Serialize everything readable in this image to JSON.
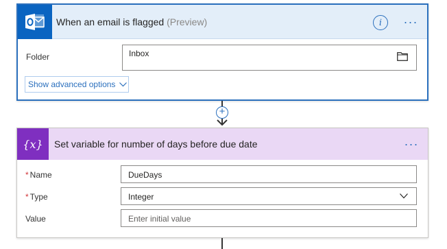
{
  "trigger": {
    "title": "When an email is flagged",
    "title_suffix": "(Preview)",
    "app_icon": "outlook-icon",
    "folder_label": "Folder",
    "folder_value": "Inbox",
    "advanced_options_label": "Show advanced options"
  },
  "variable_step": {
    "title": "Set variable for number of days before due date",
    "app_icon_text": "{x}",
    "fields": {
      "name": {
        "label": "Name",
        "required_mark": "*",
        "value": "DueDays"
      },
      "type": {
        "label": "Type",
        "required_mark": "*",
        "value": "Integer"
      },
      "value": {
        "label": "Value",
        "placeholder": "Enter initial value"
      }
    }
  },
  "colors": {
    "accent_blue": "#2a6fbd",
    "outlook_blue": "#0a64c1",
    "variable_purple": "#7f2fc0",
    "trigger_header_bg": "#e3eef9",
    "variable_header_bg": "#ead8f5",
    "required_red": "#d13438"
  }
}
